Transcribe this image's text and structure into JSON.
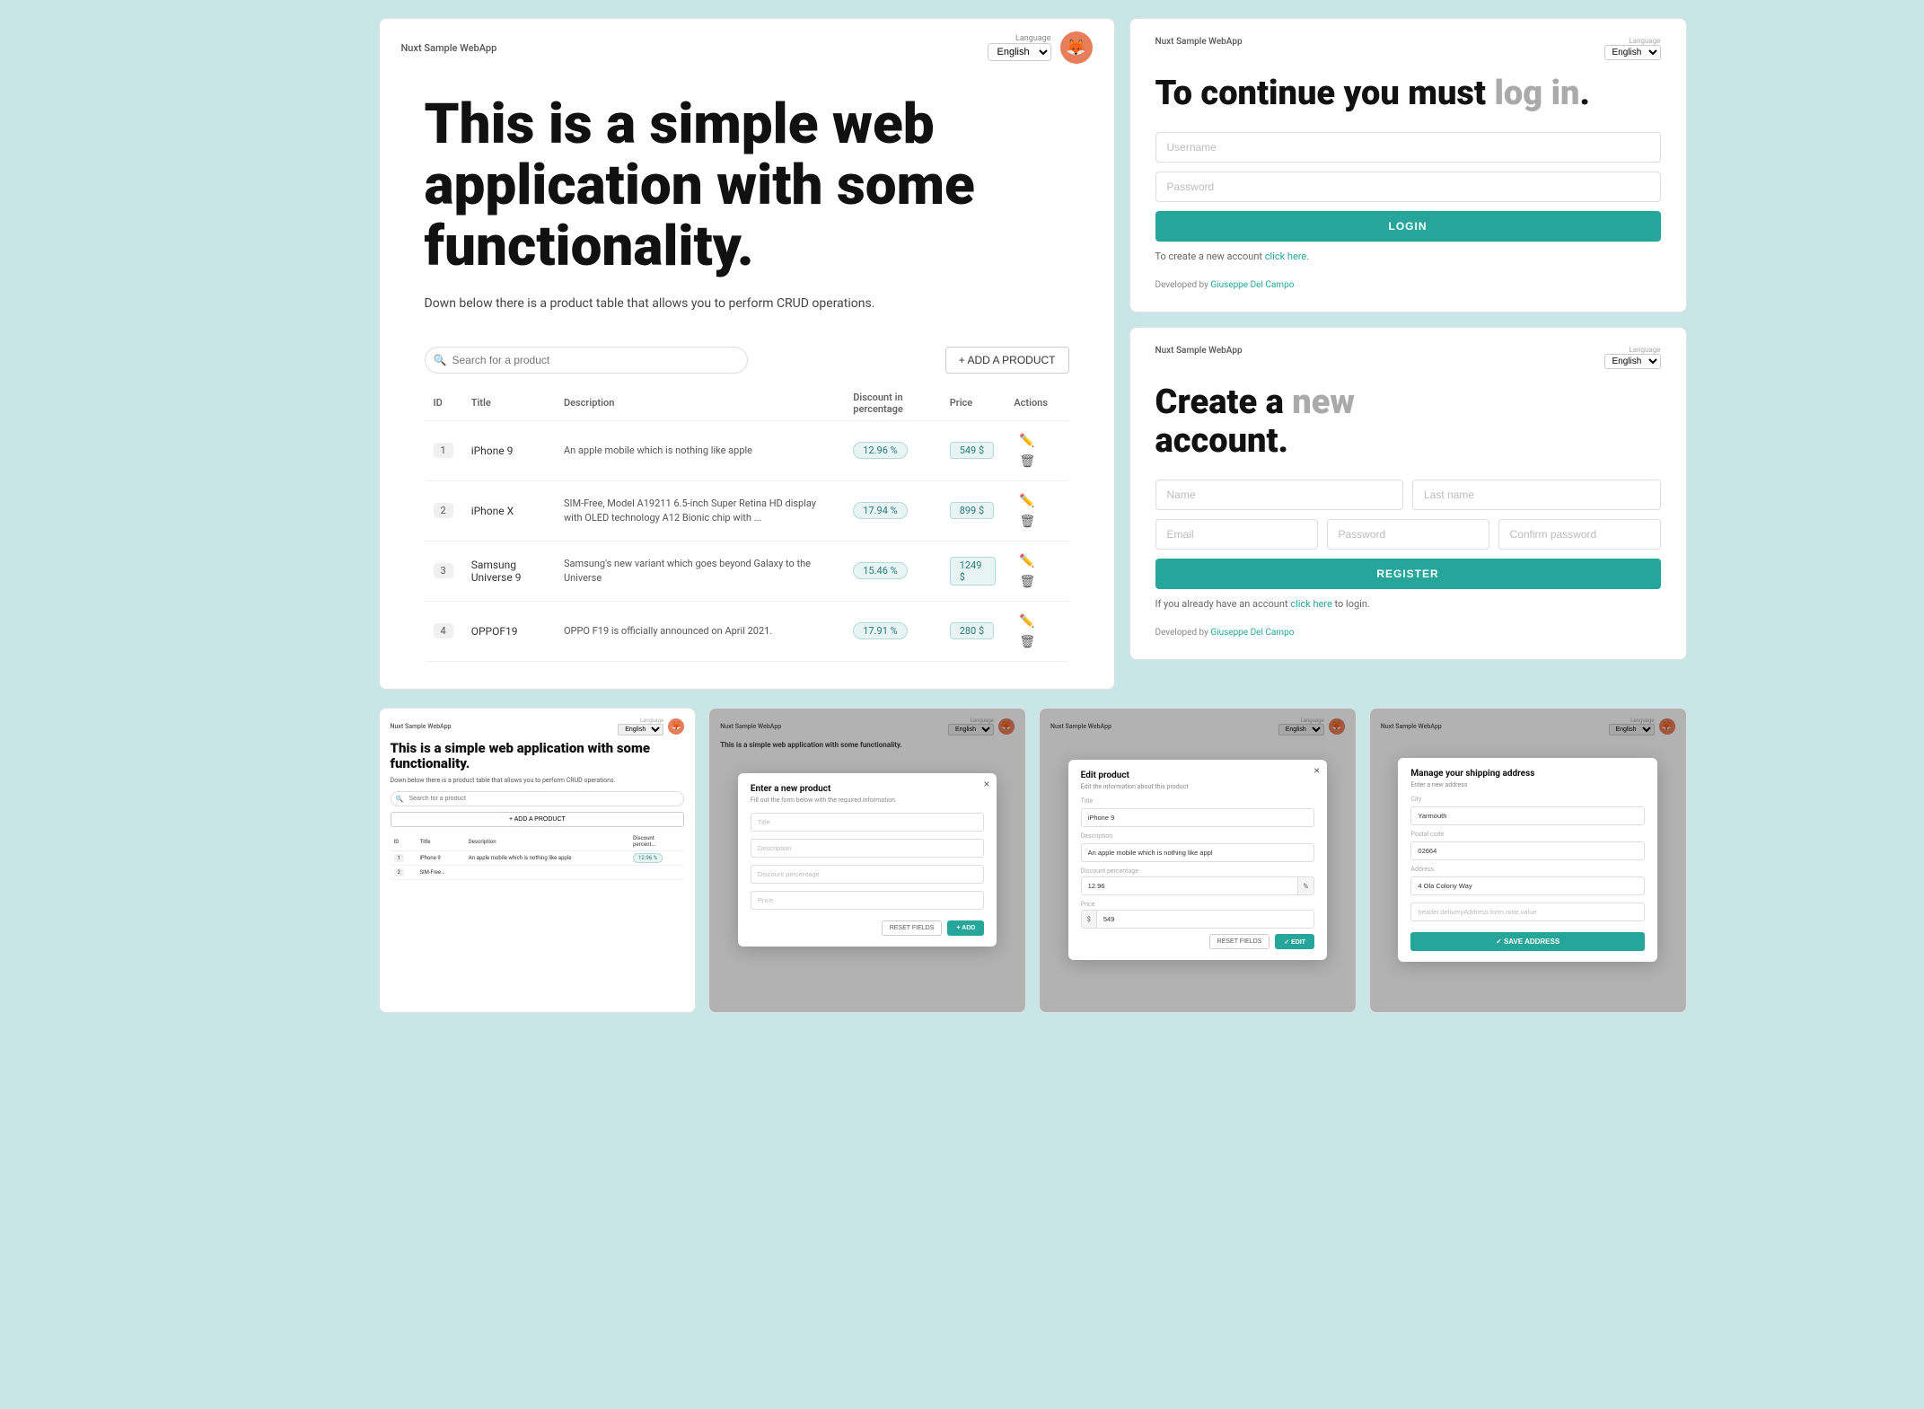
{
  "app": {
    "logo": "Nuxt Sample WebApp",
    "language_label": "Language",
    "language_value": "English",
    "avatar_emoji": "🦊",
    "hero_title": "This is a simple web application with some functionality.",
    "hero_subtitle": "Down below there is a product table that allows you to perform CRUD operations.",
    "search_placeholder": "Search for a product",
    "add_product_label": "+ ADD A PRODUCT",
    "table_headers": {
      "id": "ID",
      "title": "Title",
      "description": "Description",
      "discount": "Discount in percentage",
      "price": "Price",
      "actions": "Actions"
    },
    "products": [
      {
        "id": "1",
        "title": "iPhone 9",
        "description": "An apple mobile which is nothing like apple",
        "discount": "12.96 %",
        "price": "549 $",
        "price_num": "549"
      },
      {
        "id": "2",
        "title": "iPhone X",
        "description": "SIM-Free, Model A19211 6.5-inch Super Retina HD display with OLED technology A12 Bionic chip with ...",
        "discount": "17.94 %",
        "price": "899 $",
        "price_num": "899"
      },
      {
        "id": "3",
        "title": "Samsung Universe 9",
        "description": "Samsung's new variant which goes beyond Galaxy to the Universe",
        "discount": "15.46 %",
        "price": "1249 $",
        "price_num": "1249"
      },
      {
        "id": "4",
        "title": "OPPOF19",
        "description": "OPPO F19 is officially announced on April 2021.",
        "discount": "17.91 %",
        "price": "280 $",
        "price_num": "280"
      }
    ]
  },
  "login_panel": {
    "logo": "Nuxt Sample WebApp",
    "language_label": "Language",
    "language_value": "English",
    "title_part1": "To continue you must ",
    "title_highlight": "log in",
    "title_end": ".",
    "username_placeholder": "Username",
    "password_placeholder": "Password",
    "login_btn": "LOGIN",
    "create_hint": "To create a new account ",
    "create_link": "click here.",
    "dev_text": "Developed by ",
    "dev_name": "Giuseppe Del Campo"
  },
  "register_panel": {
    "logo": "Nuxt Sample WebApp",
    "language_label": "Language",
    "language_value": "English",
    "title_part1": "Create a ",
    "title_highlight": "new",
    "title_part2": "account",
    "title_end": ".",
    "name_placeholder": "Name",
    "lastname_placeholder": "Last name",
    "email_placeholder": "Email",
    "password_placeholder": "Password",
    "confirm_placeholder": "Confirm password",
    "register_btn": "REGISTER",
    "login_hint": "If you already have an account ",
    "login_link": "click here",
    "login_hint2": " to login.",
    "dev_text": "Developed by ",
    "dev_name": "Giuseppe Del Campo"
  },
  "mini_panels": {
    "panel1": {
      "logo": "Nuxt Sample WebApp",
      "language_label": "Language",
      "language_value": "English",
      "hero_title": "This is a simple web application with some functionality.",
      "hero_subtitle": "Down below there is a product table that allows you to perform CRUD operations.",
      "search_placeholder": "Search for a product",
      "add_btn": "+ ADD A PRODUCT",
      "table_id": "ID",
      "table_title": "Title",
      "table_desc": "Description",
      "table_discount": "Discount percent...",
      "row1_id": "1",
      "row1_title": "iPhone 9",
      "row1_desc": "An apple mobile which is nothing like apple",
      "row1_discount": "12.96 %",
      "row2_id": "2",
      "row2_title": "SIM-Free..."
    },
    "panel2_modal": {
      "logo": "Nuxt Sample WebApp",
      "language_label": "Language",
      "language_value": "English",
      "modal_title": "Enter a new product",
      "modal_subtitle": "Fill out the form below with the required information.",
      "title_placeholder": "Title",
      "description_placeholder": "Description",
      "discount_placeholder": "Discount percentage",
      "price_placeholder": "Price",
      "reset_btn": "RESET FIELDS",
      "add_btn": "+ ADD"
    },
    "panel3_modal": {
      "logo": "Nuxt Sample WebApp",
      "language_label": "Language",
      "language_value": "English",
      "modal_title": "Edit product",
      "modal_subtitle": "Edit the information about this product",
      "title_label": "Title",
      "title_value": "iPhone 9",
      "description_label": "Description",
      "description_value": "An apple mobile which is nothing like appl",
      "discount_label": "Discount percentage",
      "discount_value": "12.96",
      "discount_suffix": "%",
      "price_label": "Price",
      "price_prefix": "$",
      "price_value": "549",
      "reset_btn": "RESET FIELDS",
      "edit_btn": "✓ EDIT"
    },
    "panel4_modal": {
      "logo": "Nuxt Sample WebApp",
      "language_label": "Language",
      "language_value": "English",
      "modal_title": "Manage your shipping address",
      "modal_subtitle": "Enter a new address",
      "city_label": "City",
      "city_value": "Yarmouth",
      "postal_label": "Postal code",
      "postal_value": "02664",
      "address_label": "Address",
      "address_value": "4 Ola Colony Way",
      "note_placeholder": "header.deliveryAddress.form.note.value",
      "save_btn": "✓ SAVE ADDRESS"
    }
  }
}
